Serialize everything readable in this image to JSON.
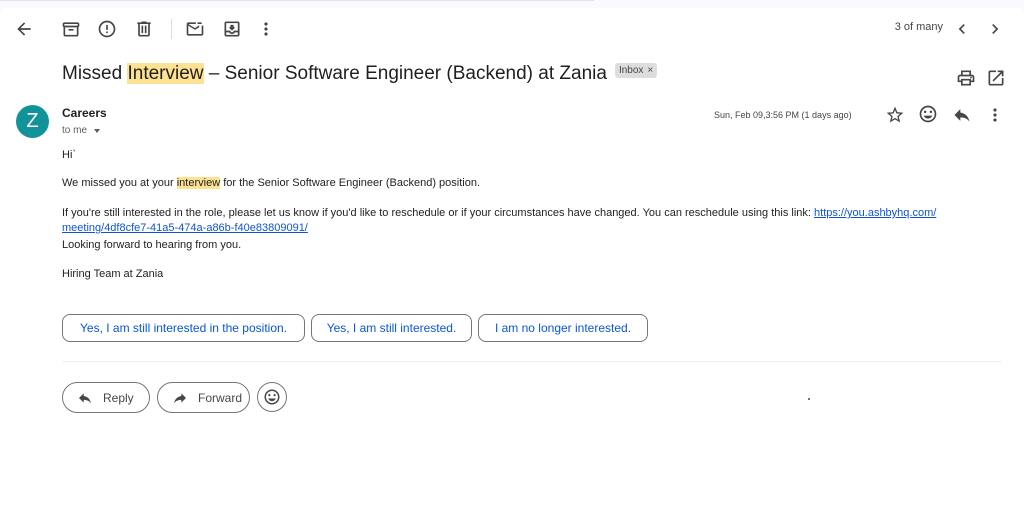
{
  "toolbar": {
    "back_icon": "arrow-back-icon",
    "archive_icon": "archive-icon",
    "report_icon": "report-spam-icon",
    "delete_icon": "trash-icon",
    "mark_unread_icon": "mark-unread-icon",
    "move_icon": "move-to-icon",
    "more_icon": "more-vert-icon",
    "pager_text": "3 of many",
    "prev_icon": "chevron-left-icon",
    "next_icon": "chevron-right-icon"
  },
  "email": {
    "subject_highlight": "Interview",
    "subject_prefix": "Missed ",
    "subject_rest": " – Senior Software Engineer (Backend) at Zania",
    "label_chip": "Inbox",
    "label_remove": "×",
    "print_icon": "print-icon",
    "open_new_window_icon": "open-in-new-icon",
    "avatar_letter": "Z",
    "sender_name": "Careers",
    "to_text": "to me",
    "date_text": "Sun, Feb 09,3:56 PM (1 days ago)",
    "star_icon": "star-icon",
    "emoji_icon": "emoji-icon",
    "reply_icon": "reply-icon",
    "more_icon": "more-vert-icon",
    "body": {
      "greeting": "Hi`",
      "line1_before": "We missed you at your ",
      "line1_highlight": "interview",
      "line1_after": " for the Senior Software Engineer (Backend) position.",
      "line2_text": "If you're still interested in the role, please let us know if you'd like to reschedule or if your circumstances have changed. You can reschedule using this link: ",
      "link_part1": "https://you.ashbyhq.com/",
      "link_part2": "meeting/4df8cfe7-41a5-474a-a86b-f40e83809091/",
      "line3": "Looking forward to hearing from you.",
      "signature": "Hiring Team at Zania"
    }
  },
  "smart_replies": [
    "Yes, I am still interested in the position.",
    "Yes, I am still interested.",
    "I am no longer interested."
  ],
  "actions": {
    "reply_label": "Reply",
    "forward_label": "Forward"
  }
}
